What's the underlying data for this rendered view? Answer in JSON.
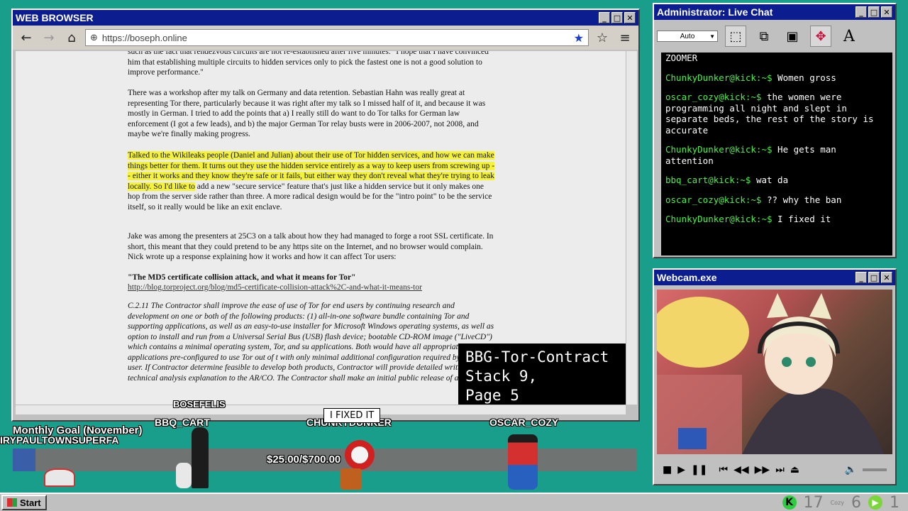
{
  "browser": {
    "title": "WEB BROWSER",
    "url": "https://boseph.online",
    "paragraphs": [
      "such as the fact that rendezvous circuits are not re-established after five minutes. \"I hope that I have convinced him that establishing multiple circuits to hidden services only to pick the fastest one is not a good solution to improve performance.\"",
      "There was a workshop after my talk on Germany and data retention. Sebastian Hahn was really great at representing Tor there, particularly because it was right after my talk so I missed half of it, and because it was mostly in German. I tried to add the points that a) I really still do want to do Tor talks for German law enforcement (I got a few leads), and b) the major German Tor relay busts were in 2006-2007, not 2008, and maybe we're finally making progress.",
      "Talked to the Wikileaks people (Daniel and Julian) about their use of Tor hidden services, and how we can make things better for them. It turns out they use the hidden service entirely as a way to keep users from screwing up -- either it works and they know they're safe or it fails, but either way they don't reveal what they're trying to leak locally. So I'd like to",
      " add a new \"secure service\" feature that's just like a hidden service but it only makes one hop from the server side rather than three. A more radical design would be for the \"intro point\" to be the service itself, so it really would be like an exit enclave.",
      "Jake was among the presenters at 25C3 on a talk about how they had managed to forge a root SSL certificate. In short, this meant that they could pretend to be any https site on the Internet, and no browser would complain. Nick wrote up a response explaining how it works and how it can affect Tor users:",
      "\"The MD5 certificate collision attack, and what it means for Tor\"",
      "http://blog.torproject.org/blog/md5-certificate-collision-attack%2C-and-what-it-means-tor",
      "C.2.11 The Contractor shall improve the ease of use of Tor for end users by continuing research and development on one or both of the following products: (1) all-in-one software bundle containing Tor and supporting applications, as well as an easy-to-use installer for Microsoft Windows operating systems, as well as option to install and run from a Universal Serial Bus (USB) flash device; bootable CD-ROM image (\"LiveCD\") which contains a minimal operating system, Tor, and su applications. Both would have all appropriate applications pre-configured to use Tor out of t with only minimal additional configuration required by the end user. If Contractor determine feasible to develop both products, Contractor will provide detailed written technical analysis explanation to the AR/CO. The Contractor shall make an initial public release of at least one"
    ],
    "overlay_lines": [
      "BBG-Tor-Contract",
      "Stack 9,",
      "Page 5"
    ]
  },
  "chat": {
    "title": "Administrator: Live Chat",
    "size_select": "Auto",
    "first_line": "ZOOMER",
    "messages": [
      {
        "user": "ChunkyDunker@kick:~$",
        "text": " Women gross"
      },
      {
        "user": "oscar_cozy@kick:~$",
        "text": " the women were programming all night and slept in separate beds, the rest of the story is accurate"
      },
      {
        "user": "ChunkyDunker@kick:~$",
        "text": " He gets man attention"
      },
      {
        "user": "bbq_cart@kick:~$",
        "text": " wat da"
      },
      {
        "user": "oscar_cozy@kick:~$",
        "text": " ?? why the ban"
      },
      {
        "user": "ChunkyDunker@kick:~$",
        "text": " I fixed it"
      }
    ]
  },
  "webcam": {
    "title": "Webcam.exe"
  },
  "stream": {
    "goal_label": "Monthly Goal (November)",
    "goal_value": "$25.00/$700.00 ",
    "goal_fraction": 0.036,
    "names": [
      "BOSEFELIS",
      "BBQ_CART",
      "CHUNKYDUNKER",
      "OSCAR_COZY",
      "IRYPAULTOWNSUPERFA"
    ],
    "speech": "I FIXED IT"
  },
  "taskbar": {
    "start": "Start",
    "tray_num1": "17",
    "tray_num2": "6",
    "tray_num3": "1",
    "tray_small": "Cozy"
  }
}
